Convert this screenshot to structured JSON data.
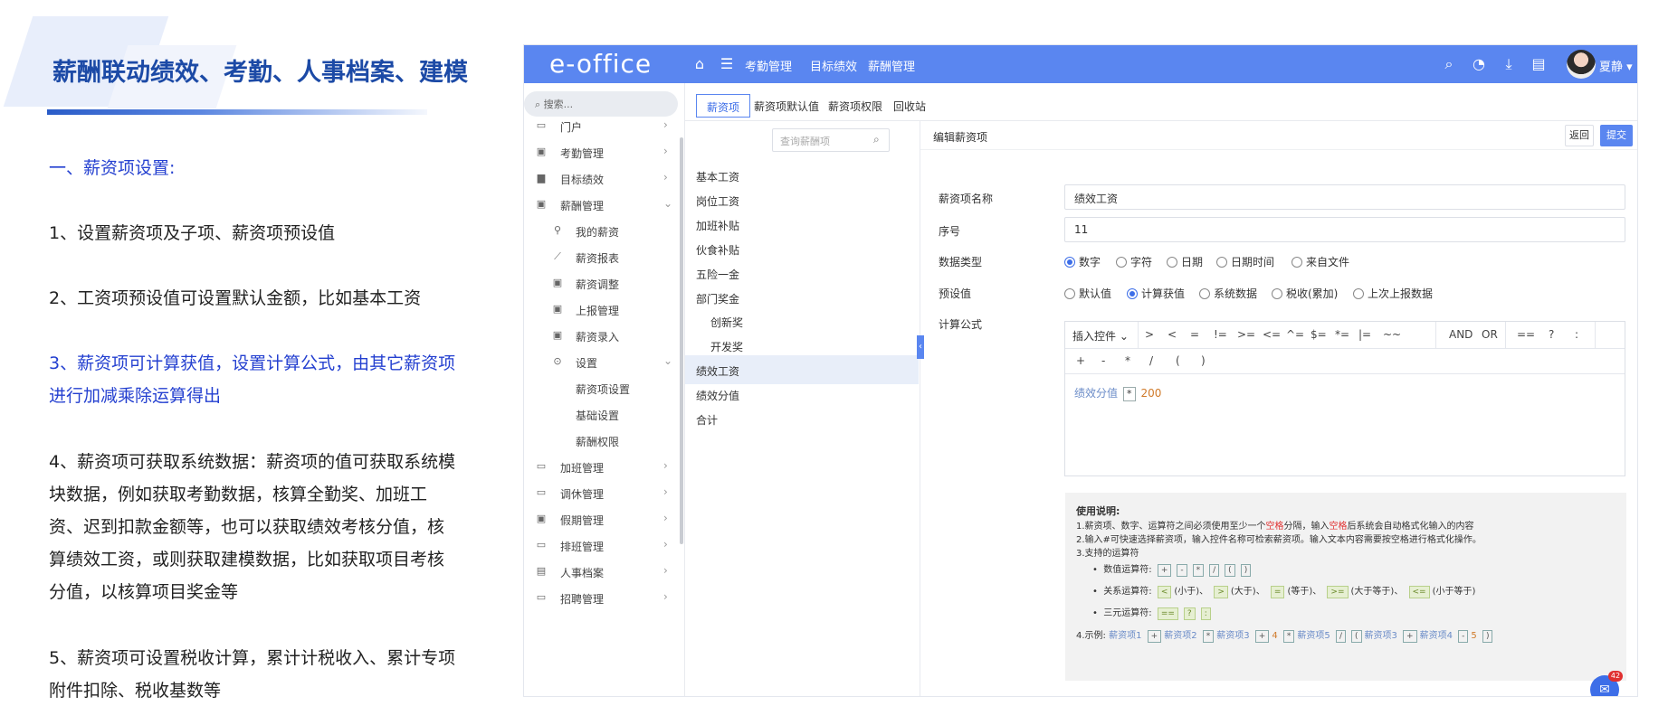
{
  "slide": {
    "title": "薪酬联动绩效、考勤、人事档案、建模",
    "section": "一、薪资项设置:",
    "points": [
      {
        "text": "1、设置薪资项及子项、薪资项预设值",
        "blue": false
      },
      {
        "text": "2、工资项预设值可设置默认金额，比如基本工资",
        "blue": false
      },
      {
        "text": "3、薪资项可计算获值，设置计算公式，由其它薪资项进行加减乘除运算得出",
        "blue": true
      },
      {
        "text": "4、薪资项可获取系统数据：薪资项的值可获取系统模块数据，例如获取考勤数据，核算全勤奖、加班工资、迟到扣款金额等，也可以获取绩效考核分值，核算绩效工资，或则获取建模数据，比如获取项目考核分值，以核算项目奖金等",
        "blue": false
      },
      {
        "text": "5、薪资项可设置税收计算，累计计税收入、累计专项附件扣除、税收基数等",
        "blue": false
      }
    ]
  },
  "app": {
    "logo": "e-office",
    "nav": [
      "考勤管理",
      "目标绩效",
      "薪酬管理"
    ],
    "username": "夏静",
    "sidebar": {
      "search_placeholder": "搜索...",
      "items": [
        {
          "label": "门户",
          "icon": "portal-icon"
        },
        {
          "label": "考勤管理",
          "icon": "clipboard-icon"
        },
        {
          "label": "目标绩效",
          "icon": "chart-icon"
        },
        {
          "label": "薪酬管理",
          "icon": "wallet-icon"
        },
        {
          "label": "我的薪资",
          "icon": "user-key-icon"
        },
        {
          "label": "薪资报表",
          "icon": "line-chart-icon"
        },
        {
          "label": "薪资调整",
          "icon": "adjust-icon"
        },
        {
          "label": "上报管理",
          "icon": "report-icon"
        },
        {
          "label": "薪资录入",
          "icon": "entry-icon"
        },
        {
          "label": "设置",
          "icon": "settings-icon"
        },
        {
          "label": "薪资项设置"
        },
        {
          "label": "基础设置"
        },
        {
          "label": "薪酬权限"
        },
        {
          "label": "加班管理",
          "icon": "overtime-icon"
        },
        {
          "label": "调休管理",
          "icon": "leave-icon"
        },
        {
          "label": "假期管理",
          "icon": "holiday-icon"
        },
        {
          "label": "排班管理",
          "icon": "schedule-icon"
        },
        {
          "label": "人事档案",
          "icon": "archive-icon"
        },
        {
          "label": "招聘管理",
          "icon": "recruit-icon"
        }
      ]
    },
    "tabs": [
      "薪资项",
      "薪资项默认值",
      "薪资项权限",
      "回收站"
    ],
    "list": {
      "search_placeholder": "查询薪酬项",
      "items": [
        {
          "label": "基本工资"
        },
        {
          "label": "岗位工资"
        },
        {
          "label": "加班补贴"
        },
        {
          "label": "伙食补贴"
        },
        {
          "label": "五险一金"
        },
        {
          "label": "部门奖金"
        },
        {
          "label": "创新奖"
        },
        {
          "label": "开发奖"
        },
        {
          "label": "绩效工资"
        },
        {
          "label": "绩效分值"
        },
        {
          "label": "合计"
        }
      ]
    },
    "form": {
      "title": "编辑薪资项",
      "back": "返回",
      "submit": "提交",
      "name_label": "薪资项名称",
      "name_value": "绩效工资",
      "order_label": "序号",
      "order_value": "11",
      "type_label": "数据类型",
      "types": [
        "数字",
        "字符",
        "日期",
        "日期时间",
        "来自文件"
      ],
      "preset_label": "预设值",
      "presets": [
        "默认值",
        "计算获值",
        "系统数据",
        "税收(累加)",
        "上次上报数据"
      ],
      "formula_label": "计算公式",
      "insert_control": "插入控件",
      "ops_row1": [
        ">",
        "<",
        "=",
        "!=",
        ">=",
        "<=",
        "^=",
        "$=",
        "*=",
        "|=",
        "~~"
      ],
      "logic_ops": [
        "AND",
        "OR"
      ],
      "ternary_ops": [
        "==",
        "?",
        ":"
      ],
      "ops_row2": [
        "+",
        "-",
        "*",
        "/",
        "(",
        ")"
      ],
      "formula": {
        "field": "绩效分值",
        "op": "*",
        "number": "200"
      }
    },
    "help": {
      "title": "使用说明:",
      "l1a": "1.薪资项、数字、运算符之间必须使用至少一个",
      "l1b": "空格",
      "l1c": "分隔，输入",
      "l1d": "空格",
      "l1e": "后系统会自动格式化输入的内容",
      "l2": "2.输入#可快速选择薪资项，输入控件名称可检索薪资项。输入文本内容需要按空格进行格式化操作。",
      "l3": "3.支持的运算符",
      "num_label": "数值运算符:",
      "num_ops": [
        "+",
        "-",
        "*",
        "/",
        "(",
        ")"
      ],
      "rel_label": "关系运算符:",
      "rel": [
        {
          "op": "<",
          "desc": "(小于)、"
        },
        {
          "op": ">",
          "desc": "(大于)、"
        },
        {
          "op": "=",
          "desc": "(等于)、"
        },
        {
          "op": ">=",
          "desc": "(大于等于)、"
        },
        {
          "op": "<=",
          "desc": "(小于等于)"
        }
      ],
      "tern_label": "三元运算符:",
      "tern_ops": [
        "==",
        "?",
        ":"
      ],
      "ex_label": "4.示例:",
      "example": [
        "薪资项1",
        "+",
        "薪资项2",
        "*",
        "薪资项3",
        "+",
        "4",
        "*",
        "薪资项5",
        "/",
        "(",
        "薪资项3",
        "+",
        "薪资项4",
        "-",
        "5",
        ")"
      ]
    },
    "chat_badge": "42"
  },
  "colors": {
    "accent": "#5a86f0",
    "title_blue": "#1c4aa6",
    "text_blue": "#2440d0",
    "red": "#e03030"
  }
}
